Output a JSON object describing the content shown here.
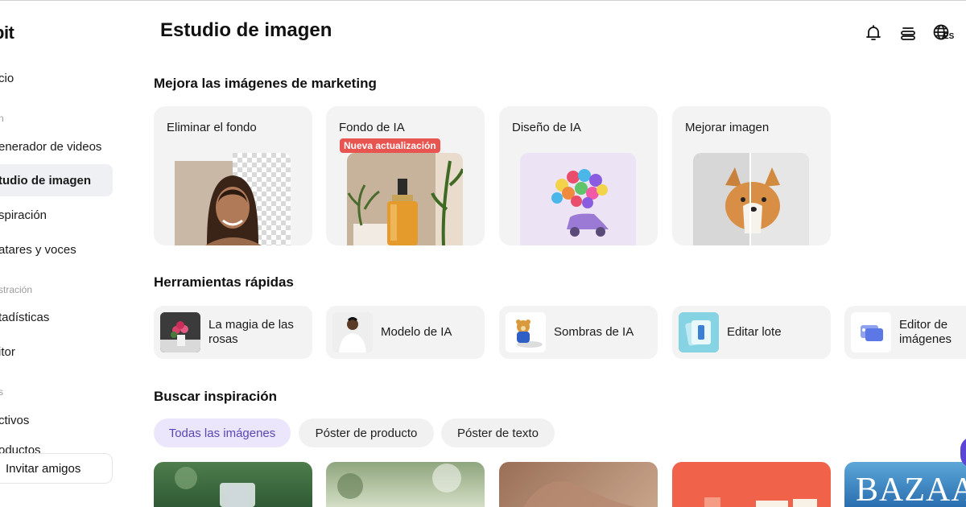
{
  "app": {
    "logo": "pit"
  },
  "sidebar": {
    "items": [
      {
        "label": "cio"
      },
      {
        "label": "enerador de videos"
      },
      {
        "label": "tudio de imagen"
      },
      {
        "label": "spiración"
      },
      {
        "label": "atares y voces"
      },
      {
        "label": "tadísticas"
      },
      {
        "label": "itor"
      },
      {
        "label": "ctivos"
      },
      {
        "label": "oductos"
      }
    ],
    "sections": [
      "n",
      "stración",
      "s"
    ],
    "invite_label": "Invitar amigos"
  },
  "header": {
    "title": "Estudio de imagen",
    "language": "ES"
  },
  "marketing": {
    "title": "Mejora las imágenes de marketing",
    "cards": [
      {
        "title": "Eliminar el fondo"
      },
      {
        "title": "Fondo de IA",
        "badge": "Nueva actualización"
      },
      {
        "title": "Diseño de IA"
      },
      {
        "title": "Mejorar imagen"
      }
    ]
  },
  "quick_tools": {
    "title": "Herramientas rápidas",
    "items": [
      {
        "label": "La magia de las rosas"
      },
      {
        "label": "Modelo de IA"
      },
      {
        "label": "Sombras de IA"
      },
      {
        "label": "Editar lote"
      },
      {
        "label": "Editor de imágenes"
      }
    ]
  },
  "inspiration": {
    "title": "Buscar inspiración",
    "filters": [
      {
        "label": "Todas las imágenes",
        "active": true
      },
      {
        "label": "Póster de producto",
        "active": false
      },
      {
        "label": "Póster de texto",
        "active": false
      }
    ],
    "tile_text": "BAZAA"
  },
  "colors": {
    "accent": "#5a47b5",
    "badge": "#e8544f",
    "card_bg": "#f3f3f3"
  }
}
